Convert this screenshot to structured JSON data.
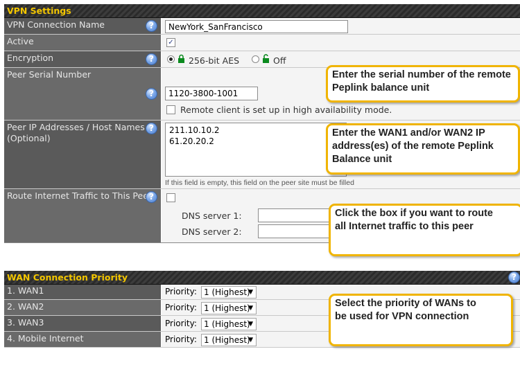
{
  "vpn": {
    "header": "VPN Settings",
    "connection_name_label": "VPN Connection Name",
    "connection_name_value": "NewYork_SanFrancisco",
    "active_label": "Active",
    "active_checked": true,
    "encryption_label": "Encryption",
    "enc_option_aes": "256-bit AES",
    "enc_option_off": "Off",
    "enc_selected": "256-bit AES",
    "peer_serial_label": "Peer Serial Number",
    "peer_serial_value": "1120-3800-1001",
    "ha_checkbox_label": "Remote client is set up in high availability mode.",
    "peer_ip_label": "Peer IP Addresses / Host Names (Optional)",
    "peer_ip_line1": "211.10.10.2",
    "peer_ip_line2": "61.20.20.2",
    "peer_ip_hint": "If this field is empty, this field on the peer site must be filled",
    "route_label": "Route Internet Traffic to This Peer",
    "dns1_label": "DNS server 1:",
    "dns2_label": "DNS server 2:"
  },
  "wan": {
    "header": "WAN Connection Priority",
    "rows": [
      {
        "label": "1. WAN1",
        "priority_label": "Priority:",
        "priority_value": "1 (Highest)"
      },
      {
        "label": "2. WAN2",
        "priority_label": "Priority:",
        "priority_value": "1 (Highest)"
      },
      {
        "label": "3. WAN3",
        "priority_label": "Priority:",
        "priority_value": "1 (Highest)"
      },
      {
        "label": "4. Mobile Internet",
        "priority_label": "Priority:",
        "priority_value": "1 (Highest)"
      }
    ]
  },
  "callouts": {
    "serial": "Enter the serial number of the remote Peplink balance unit",
    "wan_ip": "Enter the WAN1 and/or WAN2 IP address(es) of the remote Peplink Balance unit",
    "route": "Click the box if you want to route all Internet traffic to this peer",
    "priority": "Select the priority of WANs to be used for VPN connection"
  },
  "colors": {
    "header_text": "#f3c600",
    "label_bg": "#5a5a5a",
    "callout_border": "#f0b400",
    "help_icon": "#4b7fd2"
  },
  "icons": {
    "help": "question-mark",
    "lock_closed": "lock-closed",
    "lock_open": "lock-open",
    "dropdown": "chevron-down"
  }
}
